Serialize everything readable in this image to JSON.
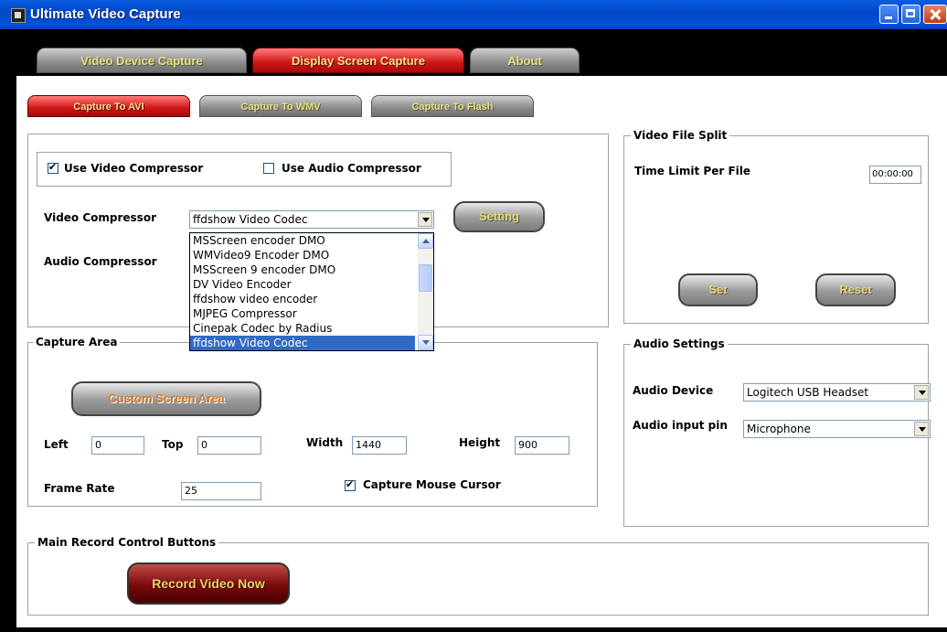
{
  "window": {
    "title": "Ultimate Video Capture"
  },
  "main_tabs": [
    {
      "label": "Video Device Capture"
    },
    {
      "label": "Display Screen Capture"
    },
    {
      "label": "About"
    }
  ],
  "sub_tabs": [
    {
      "label": "Capture To AVI"
    },
    {
      "label": "Capture To WMV"
    },
    {
      "label": "Capture To Flash"
    }
  ],
  "compressor": {
    "use_video_label": "Use Video Compressor",
    "use_video_checked": true,
    "use_audio_label": "Use Audio Compressor",
    "use_audio_checked": false,
    "video_label": "Video Compressor",
    "video_value": "ffdshow Video Codec",
    "audio_label": "Audio Compressor",
    "setting_button": "Setting",
    "dropdown_options": [
      "MSScreen encoder DMO",
      "WMVideo9 Encoder DMO",
      "MSScreen 9 encoder DMO",
      "DV Video Encoder",
      "ffdshow video encoder",
      "MJPEG Compressor",
      "Cinepak Codec by Radius",
      "ffdshow Video Codec"
    ],
    "selected_option": "ffdshow Video Codec"
  },
  "capture_area": {
    "title": "Capture Area",
    "custom_button": "Custom Screen Area",
    "left_label": "Left",
    "left_value": "0",
    "top_label": "Top",
    "top_value": "0",
    "width_label": "Width",
    "width_value": "1440",
    "height_label": "Height",
    "height_value": "900",
    "frame_rate_label": "Frame Rate",
    "frame_rate_value": "25",
    "mouse_label": "Capture Mouse Cursor",
    "mouse_checked": true
  },
  "split": {
    "title": "Video File Split",
    "time_label": "Time Limit Per  File",
    "time_value": "00:00:00",
    "set_button": "Set",
    "reset_button": "Reset"
  },
  "audio": {
    "title": "Audio Settings",
    "device_label": "Audio Device",
    "device_value": "Logitech USB Headset",
    "pin_label": "Audio input pin",
    "pin_value": "Microphone"
  },
  "record": {
    "title": "Main Record Control Buttons",
    "button": "Record Video Now"
  }
}
